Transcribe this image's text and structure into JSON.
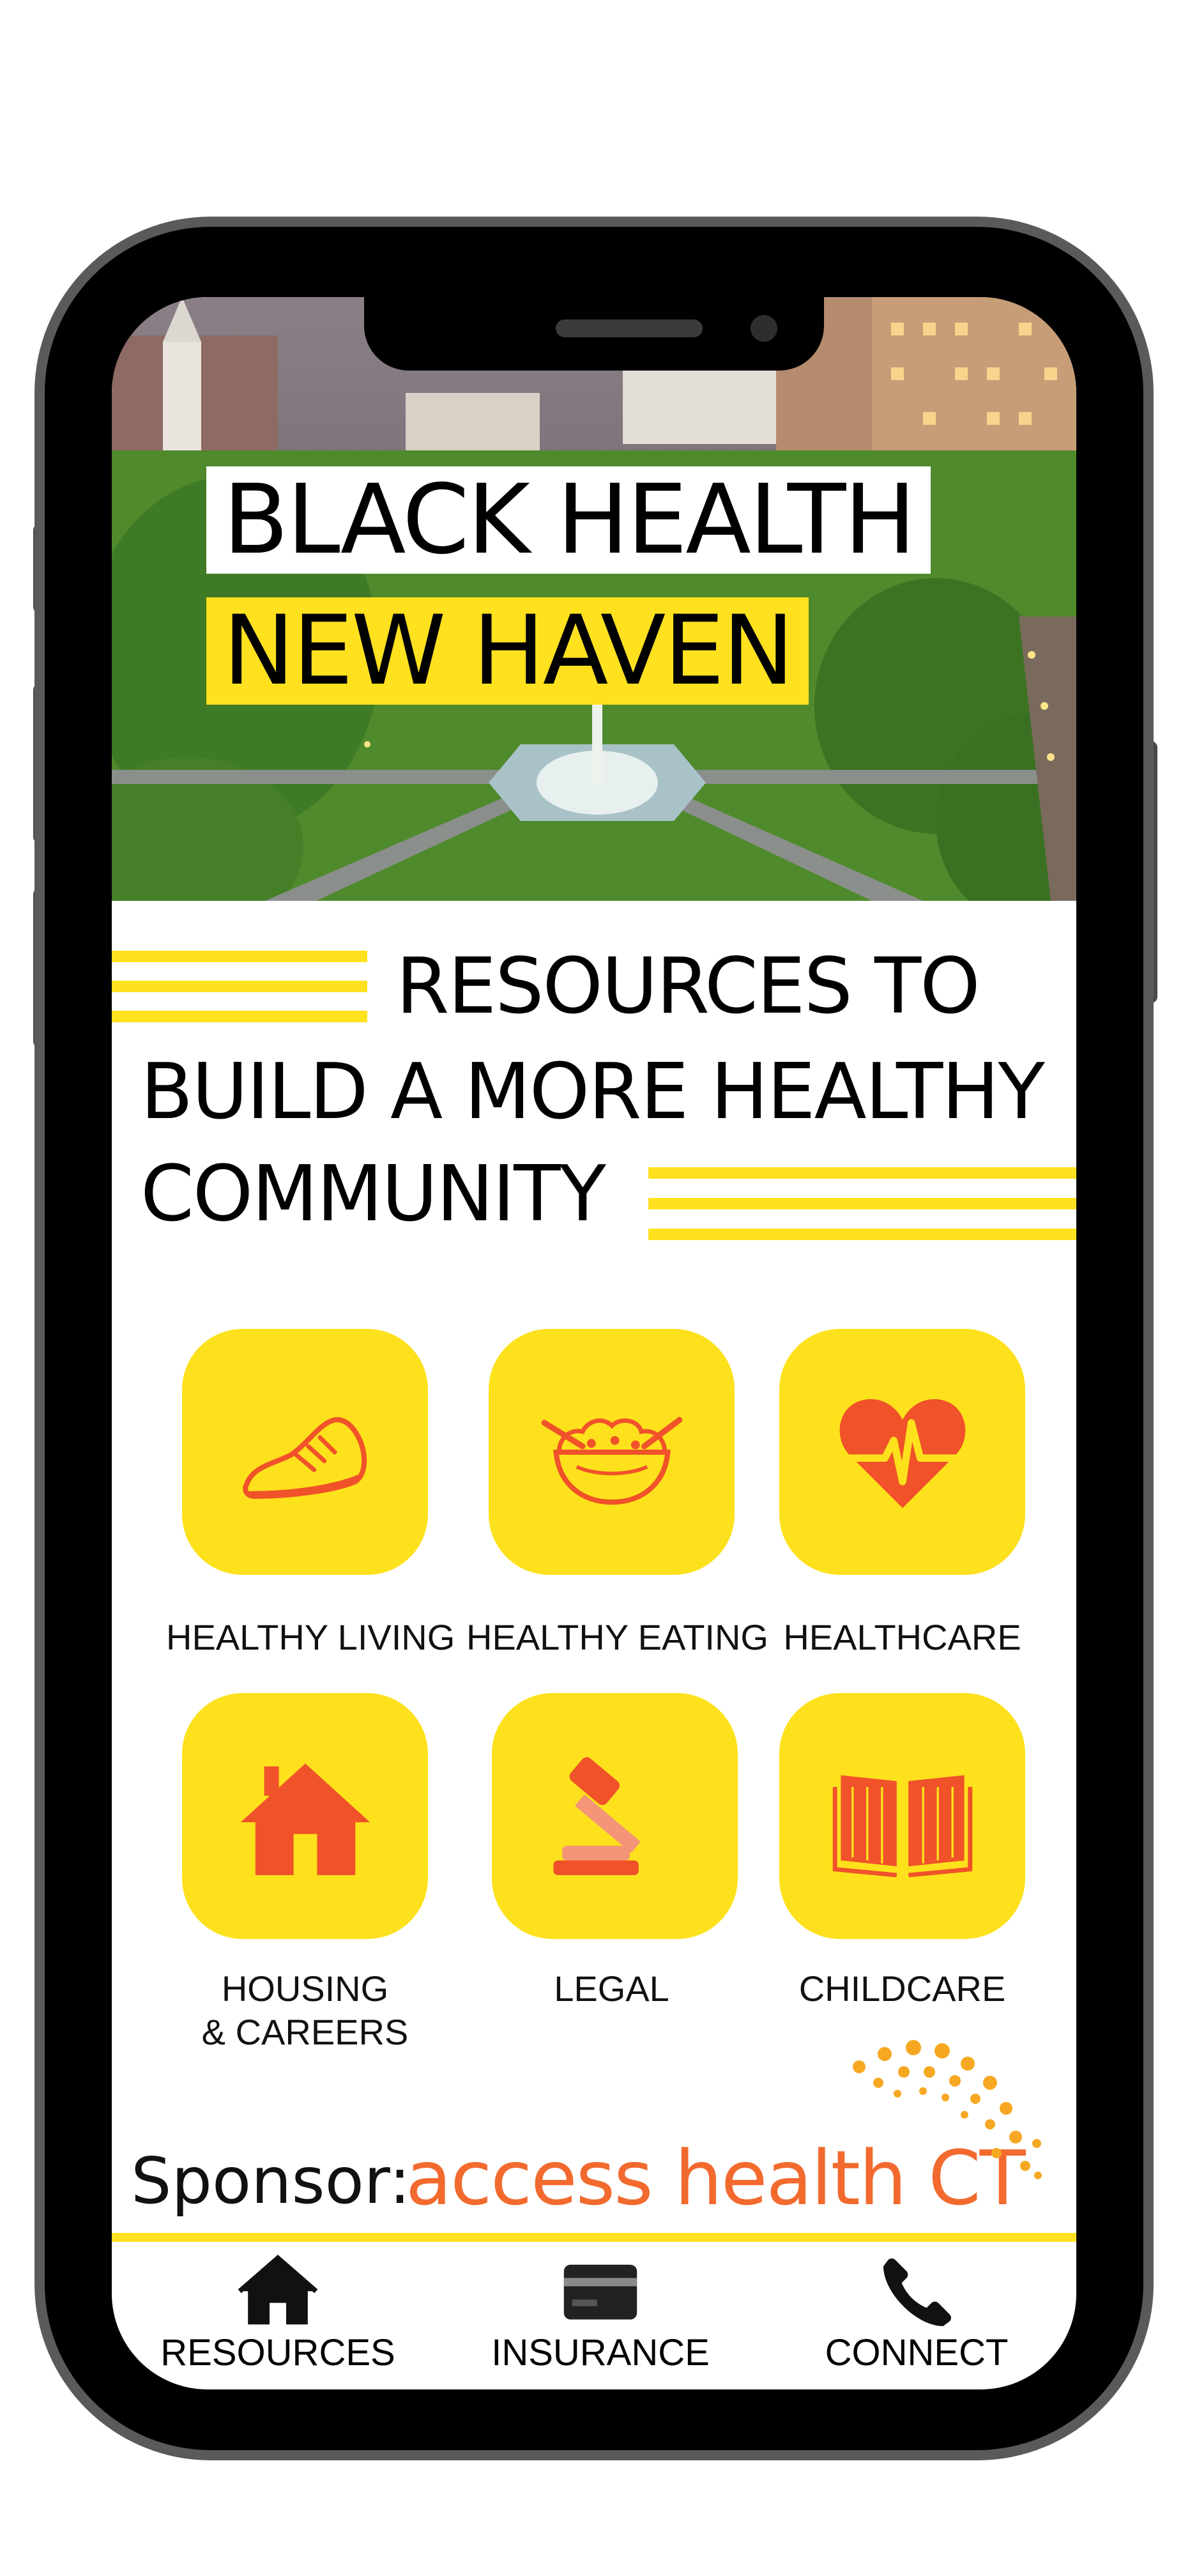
{
  "hero": {
    "title_line1": "BLACK HEALTH",
    "title_line2": "NEW HAVEN"
  },
  "headline": {
    "line1": "RESOURCES TO",
    "line2": "BUILD A MORE HEALTHY",
    "line3": "COMMUNITY"
  },
  "categories": [
    {
      "label": "HEALTHY LIVING",
      "icon": "sneaker-icon"
    },
    {
      "label": "HEALTHY EATING",
      "icon": "salad-bowl-icon"
    },
    {
      "label": "HEALTHCARE",
      "icon": "heart-pulse-icon"
    },
    {
      "label_line1": "HOUSING",
      "label_line2": "& CAREERS",
      "icon": "house-icon"
    },
    {
      "label": "LEGAL",
      "icon": "gavel-icon"
    },
    {
      "label": "CHILDCARE",
      "icon": "open-book-icon"
    }
  ],
  "sponsor": {
    "prefix": "Sponsor:",
    "brand_text": "access health",
    "brand_suffix": "CT"
  },
  "nav": {
    "items": [
      {
        "label": "RESOURCES",
        "icon": "home-icon"
      },
      {
        "label": "INSURANCE",
        "icon": "credit-card-icon"
      },
      {
        "label": "CONNECT",
        "icon": "phone-icon"
      }
    ]
  },
  "colors": {
    "accent_yellow": "#ffe11f",
    "icon_orange": "#f0522a",
    "brand_orange": "#f26a2e"
  }
}
